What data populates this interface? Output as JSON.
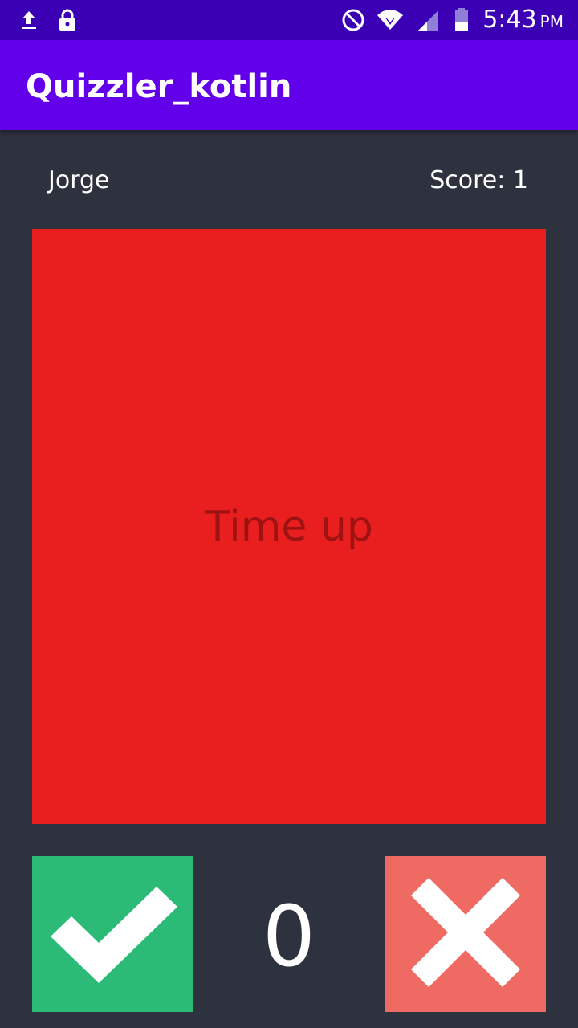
{
  "status_bar": {
    "time": "5:43",
    "ampm": "PM",
    "icons": [
      "upload-icon",
      "lock-icon",
      "do-not-disturb-icon",
      "wifi-icon",
      "signal-icon",
      "battery-icon"
    ]
  },
  "app_bar": {
    "title": "Quizzler_kotlin"
  },
  "player": {
    "name": "Jorge",
    "score_text": "Score: 1"
  },
  "question": {
    "text": "Time up"
  },
  "controls": {
    "true_icon": "checkmark-icon",
    "false_icon": "cross-icon",
    "timer": "0"
  },
  "colors": {
    "status_bar": "#3b00b3",
    "app_bar": "#6200ea",
    "background": "#2e323e",
    "question_card": "#e91f1f",
    "question_text": "#9e1212",
    "true_button": "#2cba77",
    "false_button": "#ef6a62"
  }
}
